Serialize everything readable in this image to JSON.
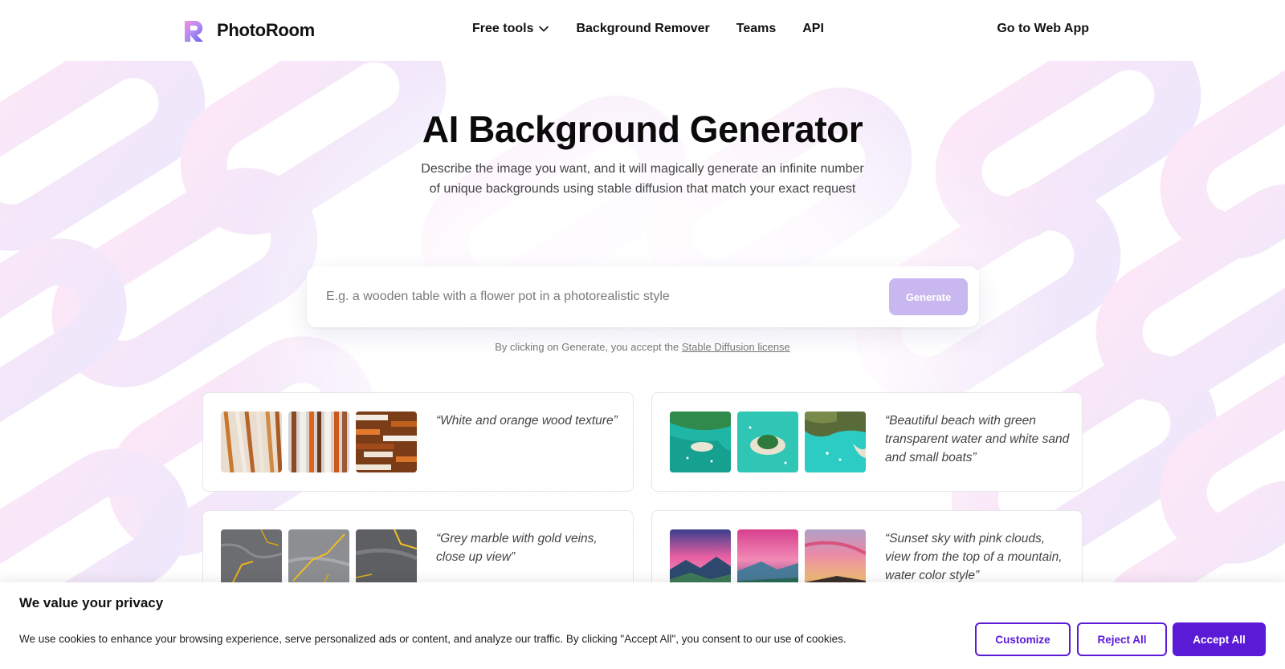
{
  "header": {
    "brand": "PhotoRoom",
    "nav": [
      "Free tools",
      "Background Remover",
      "Teams",
      "API"
    ],
    "cta": "Go to Web App"
  },
  "hero": {
    "title": "AI Background Generator",
    "subtitle": "Describe the image you want, and it will magically generate an infinite number of unique backgrounds using stable diffusion that match your exact request"
  },
  "prompt": {
    "placeholder": "E.g. a wooden table with a flower pot in a photorealistic style",
    "button": "Generate",
    "license_prefix": "By clicking on Generate, you accept the",
    "license_link": "Stable Diffusion license"
  },
  "examples": [
    {
      "text": "“White and orange wood texture”",
      "theme": "wood"
    },
    {
      "text": "“Beautiful beach with green transparent water and white sand and small boats”",
      "theme": "beach"
    },
    {
      "text": "“Grey marble with gold veins, close up view”",
      "theme": "marble"
    },
    {
      "text": "“Sunset sky with pink clouds, view from the top of a mountain, water color style”",
      "theme": "sunset"
    }
  ],
  "cookie": {
    "title": "We value your privacy",
    "text": "We use cookies to enhance your browsing experience, serve personalized ads or content, and analyze our traffic. By clicking \"Accept All\", you consent to our use of cookies.",
    "customize": "Customize",
    "reject": "Reject All",
    "accept": "Accept All"
  },
  "colors": {
    "accent": "#5a1ad6",
    "generate_disabled": "#c9b8ef",
    "pattern_pink": "#f6c6ec",
    "pattern_violet": "#dccbf6"
  },
  "icons": [
    "photoroom-logo-icon",
    "chevron-down-icon"
  ]
}
